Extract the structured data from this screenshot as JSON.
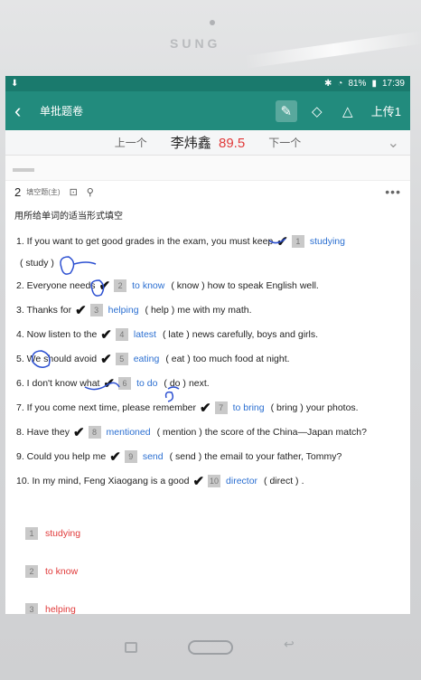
{
  "device": {
    "brand": "SUNG"
  },
  "statusbar": {
    "battery": "81%",
    "time": "17:39",
    "icons": [
      "bluetooth-icon",
      "wifi-icon",
      "battery-icon"
    ]
  },
  "appbar": {
    "title": "单批题卷",
    "upload": "上传1",
    "tools": [
      "pen-icon",
      "eraser-icon",
      "clear-icon"
    ]
  },
  "nav": {
    "prev": "上一个",
    "next": "下一个",
    "student": "李炜鑫",
    "score": "89.5"
  },
  "question": {
    "number": "2",
    "type": "填空题(主)",
    "instruction": "用所给单词的适当形式填空",
    "items": [
      {
        "pre": "1. If you want to get good grades in the exam, you must keep",
        "box": "1",
        "answer": "studying",
        "hint": "",
        "post": ""
      },
      {
        "pre": "2. Everyone needs",
        "box": "2",
        "answer": "to know",
        "hint": "( know )",
        "post": "how to speak English well."
      },
      {
        "pre": "3. Thanks for",
        "box": "3",
        "answer": "helping",
        "hint": "( help )",
        "post": "me with my math."
      },
      {
        "pre": "4. Now listen to the",
        "box": "4",
        "answer": "latest",
        "hint": "( late )",
        "post": "news carefully, boys and girls."
      },
      {
        "pre": "5. We should avoid",
        "box": "5",
        "answer": "eating",
        "hint": "( eat )",
        "post": "too much food at night."
      },
      {
        "pre": "6. I don't know what",
        "box": "6",
        "answer": "to do",
        "hint": "( do )",
        "post": "next."
      },
      {
        "pre": "7. If you come next time, please remember",
        "box": "7",
        "answer": "to bring",
        "hint": "( bring )",
        "post": "your photos."
      },
      {
        "pre": "8. Have they",
        "box": "8",
        "answer": "mentioned",
        "hint": "( mention )",
        "post": "the score of the China—Japan match?"
      },
      {
        "pre": "9. Could you help me",
        "box": "9",
        "answer": "send",
        "hint": "( send )",
        "post": "the email to your father, Tommy?"
      },
      {
        "pre": "10. In my mind, Feng Xiaogang is a good",
        "box": "10",
        "answer": "director",
        "hint": "( direct )",
        "post": "."
      }
    ],
    "item1_cont": "( study )",
    "student_answers": [
      {
        "box": "1",
        "text": "studying"
      },
      {
        "box": "2",
        "text": "to know"
      },
      {
        "box": "3",
        "text": "helping"
      }
    ]
  },
  "colors": {
    "teal": "#228b7d",
    "answer_blue": "#2b6fd1",
    "wrong_red": "#e03a3a"
  }
}
